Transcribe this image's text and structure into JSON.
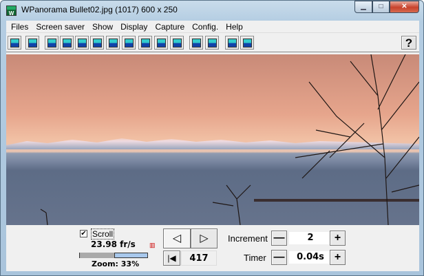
{
  "window": {
    "title": "WPanorama  Bullet02.jpg   (1017) 600 x 250",
    "app_icon": "wpanorama-icon"
  },
  "menu": [
    "Files",
    "Screen saver",
    "Show",
    "Display",
    "Capture",
    "Config.",
    "Help"
  ],
  "toolbar": {
    "help_label": "?",
    "buttons": [
      "open-file",
      "picture",
      "full-screen",
      "center",
      "top-left",
      "top-right",
      "bottom-left",
      "bottom-right",
      "film",
      "landscape",
      "wide",
      "stretch",
      "sound",
      "book",
      "help-picture"
    ]
  },
  "controls": {
    "scroll_label": "Scroll",
    "scroll_checked": true,
    "fps": "23.98 fr/s",
    "zoom_label": "Zoom: 33%",
    "zoom_percent": 33,
    "prev_symbol": "◁",
    "next_symbol": "▷",
    "first_symbol": "|◀",
    "position": "417",
    "increment_label": "Increment",
    "increment_value": "2",
    "timer_label": "Timer",
    "timer_value": "0.04s",
    "minus": "—",
    "plus": "+"
  }
}
